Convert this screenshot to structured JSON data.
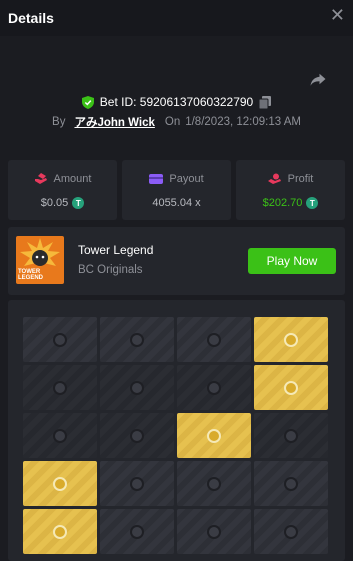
{
  "header": {
    "title": "Details",
    "close_glyph": "✕"
  },
  "bet": {
    "id_label": "Bet ID: 59206137060322790",
    "by_label": "By",
    "user": "アみJohn Wick",
    "on_label": "On",
    "datetime": "1/8/2023, 12:09:13 AM"
  },
  "stats": {
    "amount": {
      "label": "Amount",
      "value": "$0.05",
      "icon": "coin-hand-icon"
    },
    "payout": {
      "label": "Payout",
      "value": "4055.04 x",
      "icon": "wallet-icon"
    },
    "profit": {
      "label": "Profit",
      "value": "$202.70",
      "icon": "profit-icon"
    }
  },
  "game": {
    "thumb_text": "TOWER LEGEND",
    "name": "Tower Legend",
    "provider": "BC Originals",
    "play_label": "Play Now"
  },
  "board": {
    "columns": 4,
    "rows": [
      [
        "empty",
        "empty",
        "empty",
        "gold"
      ],
      [
        "empty",
        "empty",
        "empty",
        "gold"
      ],
      [
        "empty",
        "empty",
        "gold",
        "empty"
      ],
      [
        "gold",
        "empty",
        "empty",
        "empty"
      ],
      [
        "gold",
        "empty",
        "empty",
        "empty"
      ]
    ]
  },
  "colors": {
    "accent_green": "#3bc117",
    "gold": "#e6c14f",
    "background": "#1b1c21",
    "panel": "#24262c"
  }
}
